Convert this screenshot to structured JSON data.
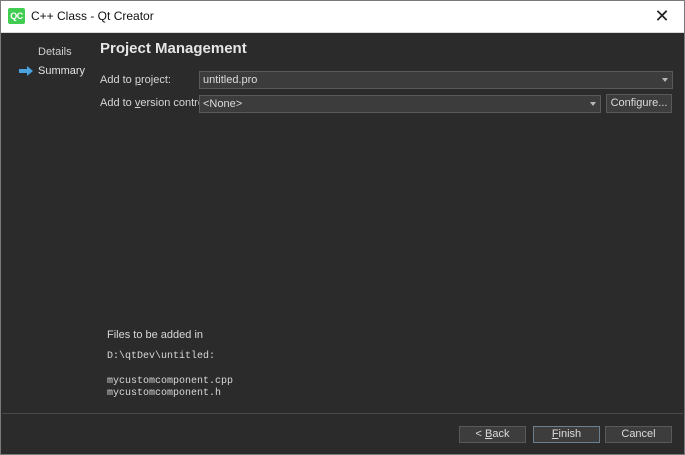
{
  "window": {
    "title": "C++ Class - Qt Creator",
    "app_icon_text": "QC",
    "close_glyph": "✕"
  },
  "sidebar": {
    "items": [
      {
        "label": "Details",
        "active": false
      },
      {
        "label": "Summary",
        "active": true
      }
    ],
    "active_indicator": "arrow-right-icon"
  },
  "page": {
    "title": "Project Management",
    "add_to_project": {
      "label_pre": "Add to ",
      "label_mnemonic": "p",
      "label_post": "roject:",
      "value": "untitled.pro"
    },
    "add_to_vcs": {
      "label_pre": "Add to ",
      "label_mnemonic": "v",
      "label_post": "ersion control:",
      "value": "<None>"
    },
    "configure_button": "Configure..."
  },
  "files": {
    "heading": "Files to be added in",
    "directory": "D:\\qtDev\\untitled:",
    "list": [
      "mycustomcomponent.cpp",
      "mycustomcomponent.h"
    ]
  },
  "footer": {
    "back_pre": "< ",
    "back_mnemonic": "B",
    "back_post": "ack",
    "finish_mnemonic": "F",
    "finish_post": "inish",
    "cancel": "Cancel"
  },
  "colors": {
    "window_bg": "#2b2b2b",
    "accent_arrow": "#4aa3df",
    "qt_green": "#41cd52"
  }
}
